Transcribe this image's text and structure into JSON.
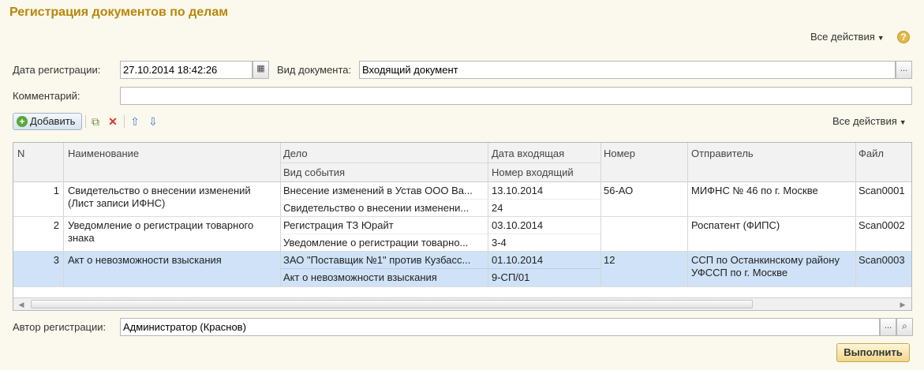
{
  "header": {
    "title": "Регистрация документов по делам",
    "all_actions": "Все действия",
    "help": "?"
  },
  "form": {
    "date_label": "Дата регистрации:",
    "date_value": "27.10.2014 18:42:26",
    "doctype_label": "Вид документа:",
    "doctype_value": "Входящий документ",
    "comment_label": "Комментарий:",
    "comment_value": "",
    "author_label": "Автор регистрации:",
    "author_value": "Администратор (Краснов)",
    "select_btn": "...",
    "search_icon": "magnifier-icon"
  },
  "toolbar": {
    "add_label": "Добавить",
    "all_actions": "Все действия",
    "icons": [
      "copy-icon",
      "delete-icon",
      "move-up-icon",
      "move-down-icon"
    ]
  },
  "table": {
    "headers": {
      "n": "N",
      "name": "Наименование",
      "case": "Дело",
      "event_type": "Вид события",
      "in_date": "Дата входящая",
      "in_number": "Номер входящий",
      "number": "Номер",
      "sender": "Отправитель",
      "file": "Файл"
    },
    "rows": [
      {
        "n": "1",
        "name1": "Свидетельство о внесении изменений",
        "name2": "(Лист записи ИФНС)",
        "case": "Внесение изменений в Устав ООО Ва...",
        "event": "Свидетельство о внесении изменени...",
        "in_date": "13.10.2014",
        "in_number": "24",
        "number": "56-АО",
        "sender1": "МИФНС № 46 по г. Москве",
        "sender2": "",
        "file": "Scan0001"
      },
      {
        "n": "2",
        "name1": "Уведомление о регистрации товарного",
        "name2": "знака",
        "case": "Регистрация ТЗ Юрайт",
        "event": "Уведомление о регистрации товарно...",
        "in_date": "03.10.2014",
        "in_number": "3-4",
        "number": "",
        "sender1": "Роспатент (ФИПС)",
        "sender2": "",
        "file": "Scan0002"
      },
      {
        "n": "3",
        "name1": "Акт о невозможности взыскания",
        "name2": "",
        "case": "ЗАО \"Поставщик №1\" против Кузбасс...",
        "event": "Акт о невозможности взыскания",
        "in_date": "01.10.2014",
        "in_number": "9-СП/01",
        "number": "12",
        "sender1": "ССП по Останкинскому району",
        "sender2": "УФССП по г. Москве",
        "file": "Scan0003"
      }
    ]
  },
  "footer": {
    "run_label": "Выполнить"
  },
  "colors": {
    "title": "#b8860b",
    "background": "#fbf9ed",
    "selected_row": "#cfe2f7"
  }
}
